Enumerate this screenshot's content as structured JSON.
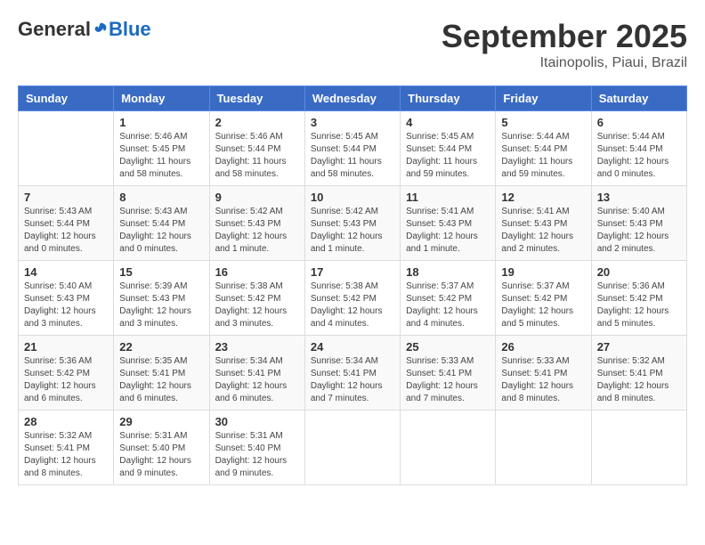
{
  "header": {
    "logo_general": "General",
    "logo_blue": "Blue",
    "month": "September 2025",
    "location": "Itainopolis, Piaui, Brazil"
  },
  "days_of_week": [
    "Sunday",
    "Monday",
    "Tuesday",
    "Wednesday",
    "Thursday",
    "Friday",
    "Saturday"
  ],
  "weeks": [
    [
      null,
      {
        "num": "1",
        "sunrise": "5:46 AM",
        "sunset": "5:45 PM",
        "daylight": "11 hours and 58 minutes."
      },
      {
        "num": "2",
        "sunrise": "5:46 AM",
        "sunset": "5:44 PM",
        "daylight": "11 hours and 58 minutes."
      },
      {
        "num": "3",
        "sunrise": "5:45 AM",
        "sunset": "5:44 PM",
        "daylight": "11 hours and 58 minutes."
      },
      {
        "num": "4",
        "sunrise": "5:45 AM",
        "sunset": "5:44 PM",
        "daylight": "11 hours and 59 minutes."
      },
      {
        "num": "5",
        "sunrise": "5:44 AM",
        "sunset": "5:44 PM",
        "daylight": "11 hours and 59 minutes."
      },
      {
        "num": "6",
        "sunrise": "5:44 AM",
        "sunset": "5:44 PM",
        "daylight": "12 hours and 0 minutes."
      }
    ],
    [
      {
        "num": "7",
        "sunrise": "5:43 AM",
        "sunset": "5:44 PM",
        "daylight": "12 hours and 0 minutes."
      },
      {
        "num": "8",
        "sunrise": "5:43 AM",
        "sunset": "5:44 PM",
        "daylight": "12 hours and 0 minutes."
      },
      {
        "num": "9",
        "sunrise": "5:42 AM",
        "sunset": "5:43 PM",
        "daylight": "12 hours and 1 minute."
      },
      {
        "num": "10",
        "sunrise": "5:42 AM",
        "sunset": "5:43 PM",
        "daylight": "12 hours and 1 minute."
      },
      {
        "num": "11",
        "sunrise": "5:41 AM",
        "sunset": "5:43 PM",
        "daylight": "12 hours and 1 minute."
      },
      {
        "num": "12",
        "sunrise": "5:41 AM",
        "sunset": "5:43 PM",
        "daylight": "12 hours and 2 minutes."
      },
      {
        "num": "13",
        "sunrise": "5:40 AM",
        "sunset": "5:43 PM",
        "daylight": "12 hours and 2 minutes."
      }
    ],
    [
      {
        "num": "14",
        "sunrise": "5:40 AM",
        "sunset": "5:43 PM",
        "daylight": "12 hours and 3 minutes."
      },
      {
        "num": "15",
        "sunrise": "5:39 AM",
        "sunset": "5:43 PM",
        "daylight": "12 hours and 3 minutes."
      },
      {
        "num": "16",
        "sunrise": "5:38 AM",
        "sunset": "5:42 PM",
        "daylight": "12 hours and 3 minutes."
      },
      {
        "num": "17",
        "sunrise": "5:38 AM",
        "sunset": "5:42 PM",
        "daylight": "12 hours and 4 minutes."
      },
      {
        "num": "18",
        "sunrise": "5:37 AM",
        "sunset": "5:42 PM",
        "daylight": "12 hours and 4 minutes."
      },
      {
        "num": "19",
        "sunrise": "5:37 AM",
        "sunset": "5:42 PM",
        "daylight": "12 hours and 5 minutes."
      },
      {
        "num": "20",
        "sunrise": "5:36 AM",
        "sunset": "5:42 PM",
        "daylight": "12 hours and 5 minutes."
      }
    ],
    [
      {
        "num": "21",
        "sunrise": "5:36 AM",
        "sunset": "5:42 PM",
        "daylight": "12 hours and 6 minutes."
      },
      {
        "num": "22",
        "sunrise": "5:35 AM",
        "sunset": "5:41 PM",
        "daylight": "12 hours and 6 minutes."
      },
      {
        "num": "23",
        "sunrise": "5:34 AM",
        "sunset": "5:41 PM",
        "daylight": "12 hours and 6 minutes."
      },
      {
        "num": "24",
        "sunrise": "5:34 AM",
        "sunset": "5:41 PM",
        "daylight": "12 hours and 7 minutes."
      },
      {
        "num": "25",
        "sunrise": "5:33 AM",
        "sunset": "5:41 PM",
        "daylight": "12 hours and 7 minutes."
      },
      {
        "num": "26",
        "sunrise": "5:33 AM",
        "sunset": "5:41 PM",
        "daylight": "12 hours and 8 minutes."
      },
      {
        "num": "27",
        "sunrise": "5:32 AM",
        "sunset": "5:41 PM",
        "daylight": "12 hours and 8 minutes."
      }
    ],
    [
      {
        "num": "28",
        "sunrise": "5:32 AM",
        "sunset": "5:41 PM",
        "daylight": "12 hours and 8 minutes."
      },
      {
        "num": "29",
        "sunrise": "5:31 AM",
        "sunset": "5:40 PM",
        "daylight": "12 hours and 9 minutes."
      },
      {
        "num": "30",
        "sunrise": "5:31 AM",
        "sunset": "5:40 PM",
        "daylight": "12 hours and 9 minutes."
      },
      null,
      null,
      null,
      null
    ]
  ]
}
